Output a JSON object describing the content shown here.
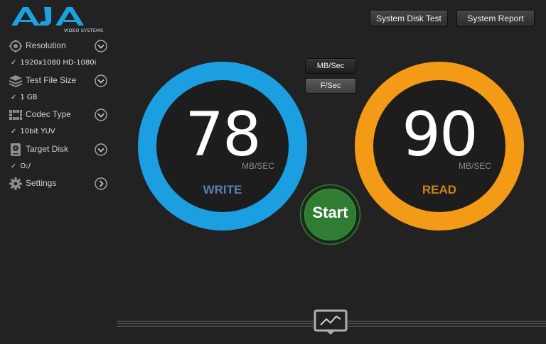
{
  "brand": {
    "logo_text": "AJA",
    "logo_subtitle": "VIDEO SYSTEMS",
    "color": "#19a3e3"
  },
  "sidebar": {
    "resolution": {
      "label": "Resolution",
      "value": "1920x1080 HD-1080i",
      "icon": "resolution-icon"
    },
    "test_file_size": {
      "label": "Test File Size",
      "value": "1 GB",
      "icon": "stack-icon"
    },
    "codec_type": {
      "label": "Codec Type",
      "value": "10bit YUV",
      "icon": "codec-grid-icon"
    },
    "target_disk": {
      "label": "Target Disk",
      "value": "O:/",
      "icon": "disk-icon"
    },
    "settings": {
      "label": "Settings",
      "icon": "gear-icon"
    }
  },
  "toolbar": {
    "system_disk_test": "System Disk Test",
    "system_report": "System Report"
  },
  "units": {
    "mb_sec": "MB/Sec",
    "f_sec": "F/Sec",
    "selected": "MB/Sec"
  },
  "write": {
    "value": "78",
    "unit": "MB/SEC",
    "label": "WRITE",
    "ring_color": "#1b9fe0",
    "label_color": "#5a7fb0"
  },
  "read": {
    "value": "90",
    "unit": "MB/SEC",
    "label": "READ",
    "ring_color": "#f39a16",
    "label_color": "#c9821c"
  },
  "start_button": {
    "label": "Start",
    "color": "#2f7d33"
  },
  "footer": {
    "icon": "line-chart-icon"
  }
}
